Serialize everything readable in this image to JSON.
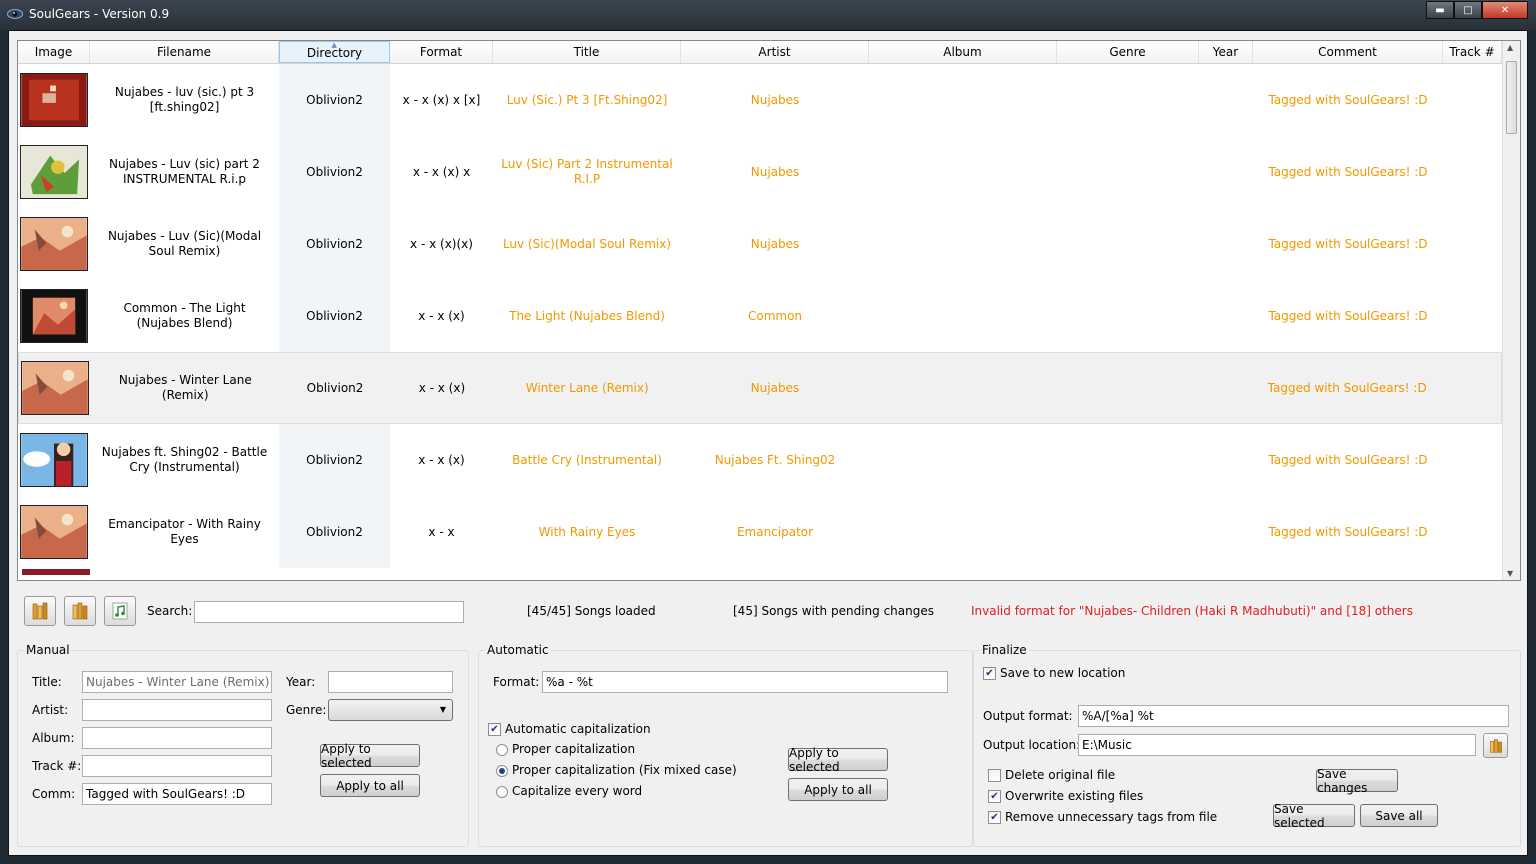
{
  "window": {
    "title": "SoulGears - Version 0.9",
    "minimize_label": "▬",
    "maximize_label": "□",
    "close_label": "✕"
  },
  "grid": {
    "columns": [
      "Image",
      "Filename",
      "Directory",
      "Format",
      "Title",
      "Artist",
      "Album",
      "Genre",
      "Year",
      "Comment",
      "Track #"
    ],
    "rows": [
      {
        "filename": "Nujabes - luv (sic.) pt 3 [ft.shing02]",
        "directory": "Oblivion2",
        "format": "x - x (x) x [x]",
        "title": "Luv (Sic.) Pt 3   [Ft.Shing02]",
        "artist": "Nujabes",
        "album": "",
        "genre": "",
        "year": "",
        "comment": "Tagged with SoulGears! :D",
        "track": ""
      },
      {
        "filename": "Nujabes - Luv (sic) part 2 INSTRUMENTAL R.i.p",
        "directory": "Oblivion2",
        "format": "x - x (x) x",
        "title": "Luv (Sic) Part 2 Instrumental R.I.P",
        "artist": "Nujabes",
        "album": "",
        "genre": "",
        "year": "",
        "comment": "Tagged with SoulGears! :D",
        "track": ""
      },
      {
        "filename": "Nujabes - Luv (Sic)(Modal Soul Remix)",
        "directory": "Oblivion2",
        "format": "x - x (x)(x)",
        "title": "Luv (Sic)(Modal Soul Remix)",
        "artist": "Nujabes",
        "album": "",
        "genre": "",
        "year": "",
        "comment": "Tagged with SoulGears! :D",
        "track": ""
      },
      {
        "filename": "Common - The Light (Nujabes Blend)",
        "directory": "Oblivion2",
        "format": "x - x (x)",
        "title": "The Light (Nujabes Blend)",
        "artist": "Common",
        "album": "",
        "genre": "",
        "year": "",
        "comment": "Tagged with SoulGears! :D",
        "track": ""
      },
      {
        "filename": "Nujabes - Winter Lane (Remix)",
        "directory": "Oblivion2",
        "format": "x - x (x)",
        "title": "Winter Lane (Remix)",
        "artist": "Nujabes",
        "album": "",
        "genre": "",
        "year": "",
        "comment": "Tagged with SoulGears! :D",
        "track": ""
      },
      {
        "filename": "Nujabes ft. Shing02 - Battle Cry (Instrumental)",
        "directory": "Oblivion2",
        "format": "x - x (x)",
        "title": "Battle Cry (Instrumental)",
        "artist": "Nujabes Ft. Shing02",
        "album": "",
        "genre": "",
        "year": "",
        "comment": "Tagged with SoulGears! :D",
        "track": ""
      },
      {
        "filename": "Emancipator - With Rainy Eyes",
        "directory": "Oblivion2",
        "format": "x - x",
        "title": "With Rainy Eyes",
        "artist": "Emancipator",
        "album": "",
        "genre": "",
        "year": "",
        "comment": "Tagged with SoulGears! :D",
        "track": ""
      }
    ]
  },
  "toolbar": {
    "search_label": "Search:",
    "search_value": "",
    "songs_loaded": "[45/45] Songs loaded",
    "pending_changes": "[45] Songs with pending changes",
    "error_message": "Invalid format for \"Nujabes- Children (Haki R Madhubuti)\" and [18] others"
  },
  "manual": {
    "group_label": "Manual",
    "title_label": "Title:",
    "title_value": "Nujabes - Winter Lane (Remix)",
    "artist_label": "Artist:",
    "artist_value": "",
    "album_label": "Album:",
    "album_value": "",
    "track_label": "Track #:",
    "track_value": "",
    "comm_label": "Comm:",
    "comm_value": "Tagged with SoulGears! :D",
    "year_label": "Year:",
    "year_value": "",
    "genre_label": "Genre:",
    "genre_value": "",
    "apply_selected": "Apply to selected",
    "apply_all": "Apply to all"
  },
  "automatic": {
    "group_label": "Automatic",
    "format_label": "Format:",
    "format_value": "%a - %t",
    "auto_cap_label": "Automatic capitalization",
    "auto_cap_checked": true,
    "options": [
      "Proper capitalization",
      "Proper capitalization (Fix mixed case)",
      "Capitalize every word"
    ],
    "selected_option": 1,
    "apply_selected": "Apply to selected",
    "apply_all": "Apply to all"
  },
  "finalize": {
    "group_label": "Finalize",
    "save_new_location": "Save to new location",
    "save_new_location_checked": true,
    "output_format_label": "Output format:",
    "output_format_value": "%A/[%a] %t",
    "output_location_label": "Output location:",
    "output_location_value": "E:\\Music",
    "delete_original": "Delete original file",
    "delete_original_checked": false,
    "overwrite_existing": "Overwrite existing files",
    "overwrite_existing_checked": true,
    "remove_tags": "Remove unnecessary tags from file",
    "remove_tags_checked": true,
    "save_changes": "Save changes",
    "save_selected": "Save selected",
    "save_all": "Save all"
  },
  "colors": {
    "tag_text": "#f19800",
    "error_text": "#e02020",
    "selection_row": "#f1f1f1"
  }
}
